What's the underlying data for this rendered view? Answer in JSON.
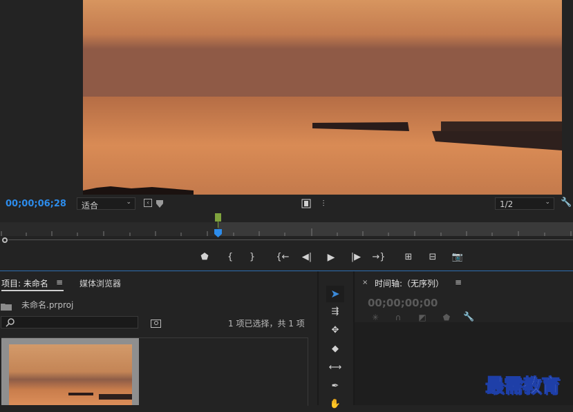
{
  "monitor": {
    "timecode": "00;00;06;28",
    "fit_label": "适合",
    "resolution": "1/2",
    "playhead_fraction": 0.38
  },
  "transport": {
    "icons": [
      "marker-icon",
      "mark-in-icon",
      "mark-out-icon",
      "go-to-in-icon",
      "step-back-icon",
      "play-icon",
      "step-forward-icon",
      "go-to-out-icon",
      "insert-icon",
      "overwrite-icon",
      "export-frame-icon"
    ]
  },
  "project": {
    "tab_label": "项目: 未命名",
    "menu_glyph": "≡",
    "media_browser_tab": "媒体浏览器",
    "file_name": "未命名.prproj",
    "selection_status": "1 项已选择，共 1 项"
  },
  "timeline": {
    "close_glyph": "×",
    "tab_label": "时间轴:（无序列）",
    "menu_glyph": "≡",
    "timecode": "00;00;00;00"
  },
  "watermark": "最需教育",
  "colors": {
    "accent": "#2d8ceb",
    "panel": "#232323",
    "tool_active": "#3b8ad9"
  }
}
